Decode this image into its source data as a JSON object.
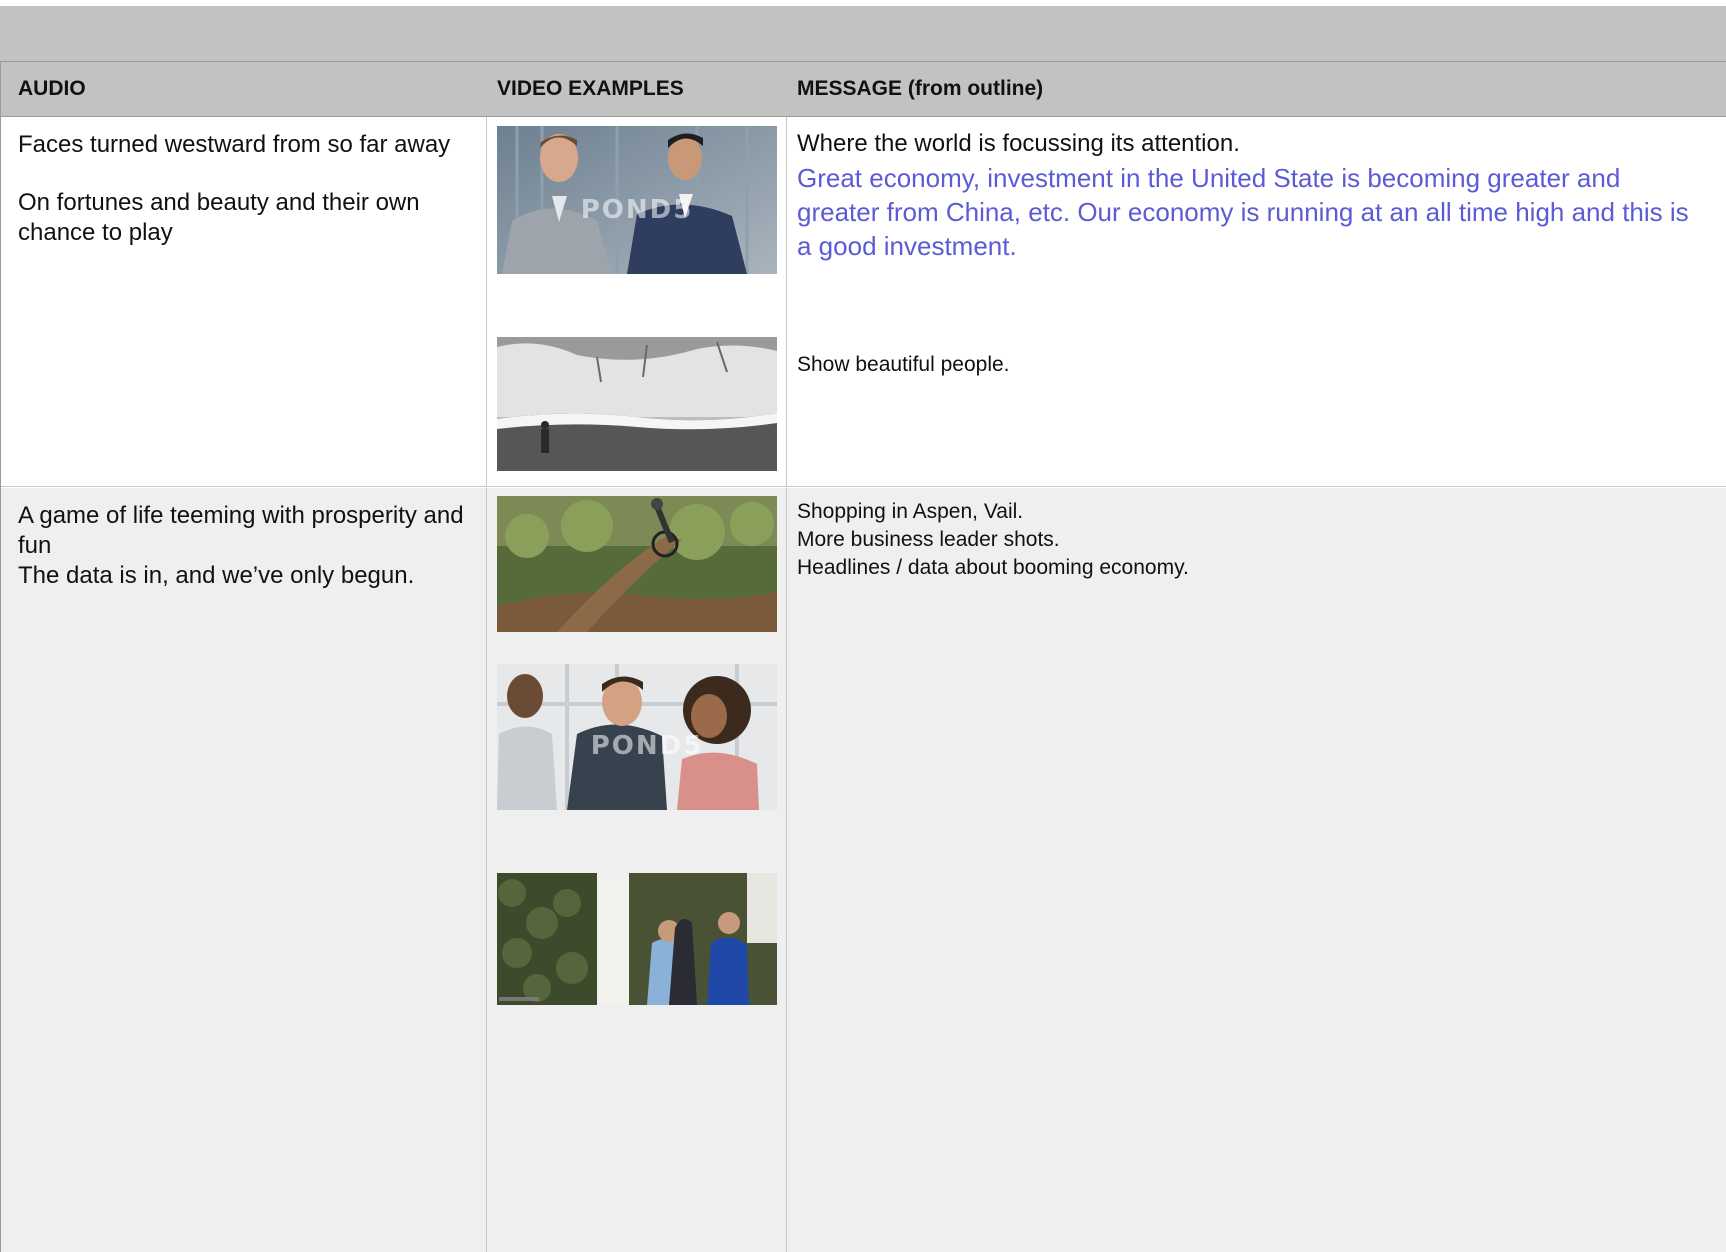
{
  "columns": {
    "audio": "AUDIO",
    "video": "VIDEO EXAMPLES",
    "message": "MESSAGE (from outline)"
  },
  "rows": [
    {
      "audio": [
        "Faces turned westward from so far away",
        "On fortunes and beauty and their own chance to play"
      ],
      "videos": [
        {
          "icon": "business-men-video-thumbnail",
          "watermark": "POND5"
        },
        {
          "icon": "snowy-river-video-thumbnail"
        }
      ],
      "message": {
        "line1": "Where the world is focussing its attention.",
        "highlight": "Great economy, investment in the United State is becoming greater and greater from China, etc. Our economy is running at an all time high and this is a good investment.",
        "note": "Show beautiful people."
      }
    },
    {
      "audio": [
        "A game of life teeming with prosperity and fun",
        "The data is in, and we’ve only begun."
      ],
      "videos": [
        {
          "icon": "mountain-biker-video-thumbnail"
        },
        {
          "icon": "office-meeting-video-thumbnail",
          "watermark": "POND5"
        },
        {
          "icon": "shopping-street-video-thumbnail"
        }
      ],
      "message": {
        "lines": [
          "Shopping in Aspen, Vail.",
          "More business leader shots.",
          "Headlines / data about booming economy."
        ]
      }
    }
  ],
  "colors": {
    "header_bg": "#c1c3c1",
    "highlight_text": "#5b5bd6",
    "row2_bg": "#efefef"
  }
}
